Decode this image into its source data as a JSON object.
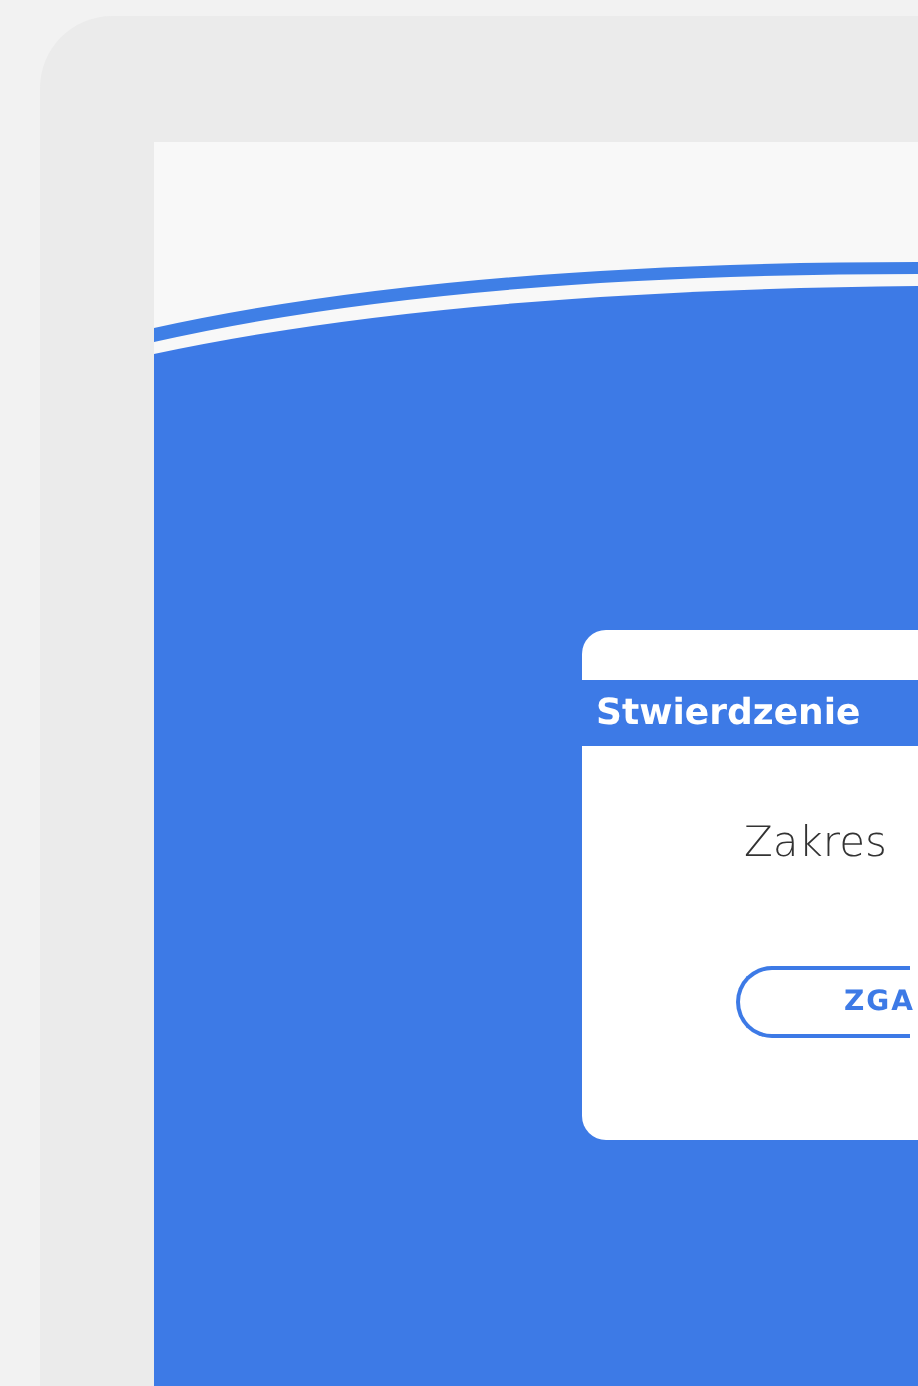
{
  "dialog": {
    "title": "Stwierdzenie",
    "message": "Zakres",
    "buttons": [
      "ZGA"
    ]
  }
}
